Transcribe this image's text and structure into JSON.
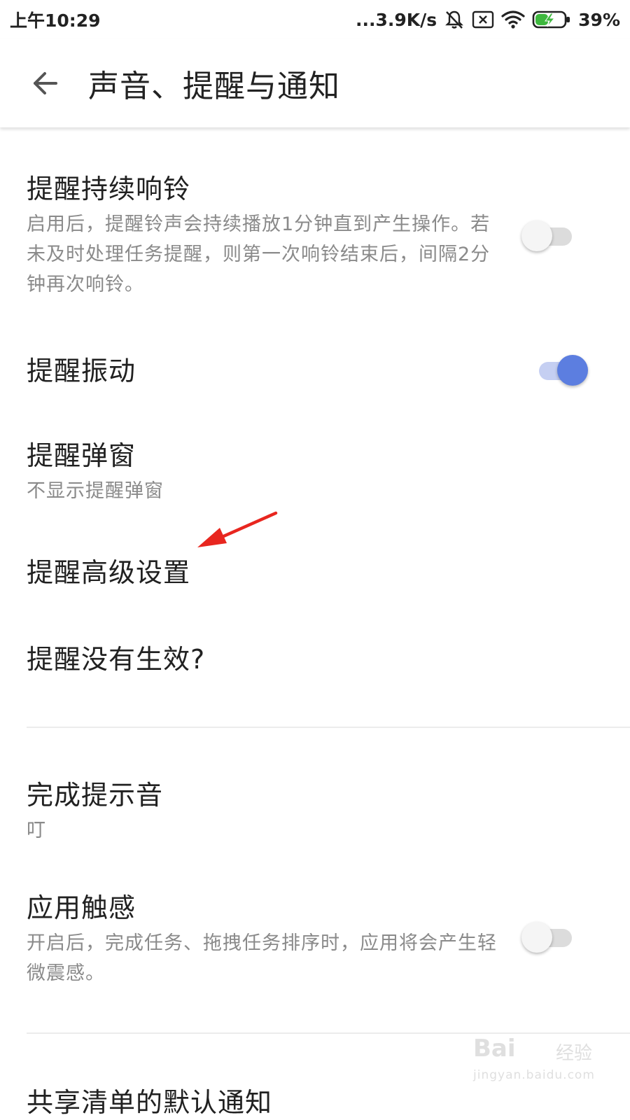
{
  "status_bar": {
    "time": "上午10:29",
    "network_speed": "...3.9K/s",
    "battery": "39%",
    "icons": [
      "bell-muted-icon",
      "sim-off-icon",
      "wifi-icon",
      "battery-charging-icon"
    ]
  },
  "toolbar": {
    "back_icon": "arrow-left-icon",
    "title": "声音、提醒与通知"
  },
  "settings": {
    "persistent_ring": {
      "title": "提醒持续响铃",
      "description": "启用后，提醒铃声会持续播放1分钟直到产生操作。若未及时处理任务提醒，则第一次响铃结束后，间隔2分钟再次响铃。",
      "enabled": false
    },
    "vibration": {
      "title": "提醒振动",
      "enabled": true
    },
    "popup": {
      "title": "提醒弹窗",
      "value": "不显示提醒弹窗"
    },
    "advanced": {
      "title": "提醒高级设置"
    },
    "not_working": {
      "title": "提醒没有生效?"
    },
    "completion_sound": {
      "title": "完成提示音",
      "value": "叮"
    },
    "haptics": {
      "title": "应用触感",
      "description": "开启后，完成任务、拖拽任务排序时，应用将会产生轻微震感。",
      "enabled": false
    },
    "next_section_partial": {
      "title": "共享清单的默认通知"
    }
  },
  "annotation": {
    "color": "#e8261f"
  },
  "watermark": {
    "brand": "Bai",
    "suffix": "经验",
    "url": "jingyan.baidu.com"
  },
  "colors": {
    "accent": "#5c7ee0",
    "accent_track": "#c5cff2",
    "switch_off_track": "#dcdcdc",
    "text_primary": "#212121",
    "text_secondary": "#8a8a8a"
  }
}
